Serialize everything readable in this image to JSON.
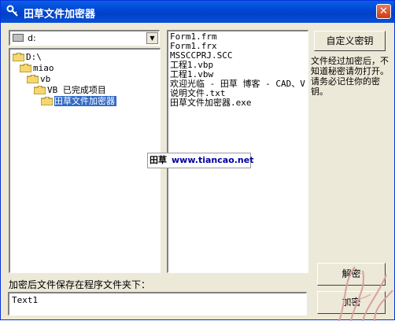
{
  "window": {
    "title": "田草文件加密器",
    "close_label": "✕"
  },
  "drive": {
    "value": "d:"
  },
  "directories": [
    {
      "label": "D:\\",
      "depth": 0
    },
    {
      "label": "miao",
      "depth": 1
    },
    {
      "label": "vb",
      "depth": 2
    },
    {
      "label": "VB 已完成项目",
      "depth": 3
    },
    {
      "label": "田草文件加密器",
      "depth": 4,
      "selected": true
    }
  ],
  "files": [
    "Form1.frm",
    "Form1.frx",
    "MSSCCPRJ.SCC",
    "工程1.vbp",
    "工程1.vbw",
    "欢迎光临 - 田草 博客 - CAD、V",
    "说明文件.txt",
    "田草文件加密器.exe"
  ],
  "buttons": {
    "custom_key": "自定义密钥",
    "decrypt": "解密",
    "encrypt": "加密"
  },
  "info_text": "文件经过加密后，不知道秘密请勿打开。请务必记住你的密钥。",
  "save_label": "加密后文件保存在程序文件夹下：",
  "output_value": "Text1",
  "watermark": {
    "cn": "田草",
    "url": "www.tiancao.net"
  },
  "colors": {
    "titlebar": "#0048d4",
    "selection": "#316ac5",
    "face": "#ece9d8"
  }
}
